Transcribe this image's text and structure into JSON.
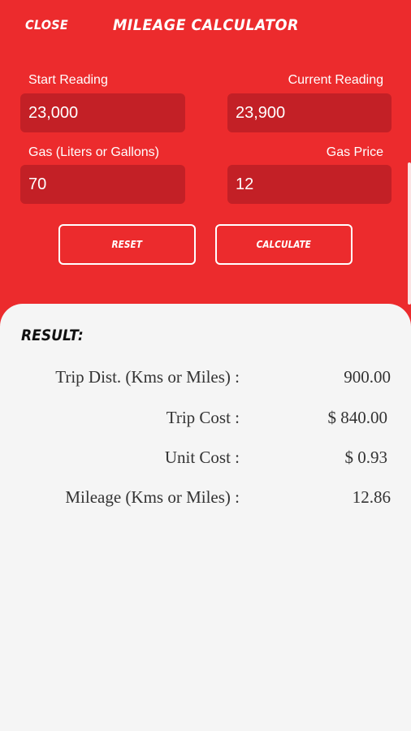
{
  "header": {
    "close_label": "CLOSE",
    "title": "MILEAGE CALCULATOR"
  },
  "form": {
    "start_reading": {
      "label": "Start Reading",
      "value": "23,000"
    },
    "current_reading": {
      "label": "Current Reading",
      "value": "23,900"
    },
    "gas": {
      "label": "Gas (Liters or Gallons)",
      "value": "70"
    },
    "gas_price": {
      "label": "Gas Price",
      "value": "12"
    }
  },
  "buttons": {
    "reset_label": "RESET",
    "calculate_label": "CALCULATE"
  },
  "result": {
    "heading": "RESULT:",
    "rows": [
      {
        "label": "Trip Dist. (Kms or Miles) :",
        "value": "900.00"
      },
      {
        "label": "Trip Cost :",
        "value": "$ 840.00"
      },
      {
        "label": "Unit Cost :",
        "value": "$ 0.93"
      },
      {
        "label": "Mileage (Kms or Miles) :",
        "value": "12.86"
      }
    ]
  },
  "colors": {
    "primary": "#ec2b2d",
    "field_bg": "#c32026",
    "result_bg": "#f5f5f5"
  }
}
